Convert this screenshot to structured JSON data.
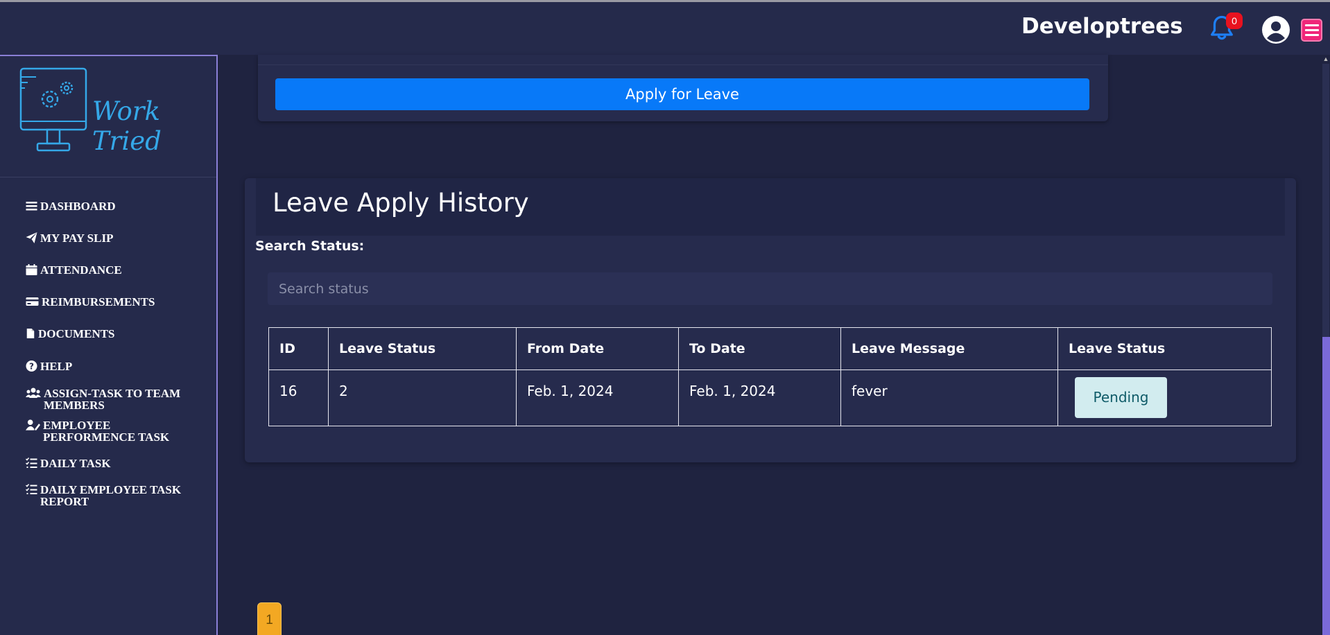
{
  "header": {
    "brand": "Developtrees",
    "notification_count": "0"
  },
  "sidebar": {
    "logo_text": "Work Tried",
    "items": [
      {
        "label": "DASHBOARD",
        "icon": "bars-icon"
      },
      {
        "label": "MY PAY SLIP",
        "icon": "paper-plane-icon"
      },
      {
        "label": "ATTENDANCE",
        "icon": "calendar-icon"
      },
      {
        "label": "REIMBURSEMENTS",
        "icon": "credit-card-icon"
      },
      {
        "label": "DOCUMENTS",
        "icon": "file-icon"
      },
      {
        "label": "HELP",
        "icon": "question-circle-icon"
      },
      {
        "label": "ASSIGN-TASK TO TEAM MEMBERS",
        "icon": "users-icon"
      },
      {
        "label": "EMPLOYEE PERFORMENCE TASK",
        "icon": "user-edit-icon"
      },
      {
        "label": "DAILY TASK",
        "icon": "list-check-icon"
      },
      {
        "label": "DAILY EMPLOYEE TASK REPORT",
        "icon": "list-check-icon"
      }
    ]
  },
  "apply": {
    "button_label": "Apply for Leave"
  },
  "history": {
    "title": "Leave Apply History",
    "search_label": "Search Status:",
    "search_placeholder": "Search status",
    "columns": [
      "ID",
      "Leave Status",
      "From Date",
      "To Date",
      "Leave Message",
      "Leave Status"
    ],
    "rows": [
      {
        "id": "16",
        "leave_status": "2",
        "from_date": "Feb. 1, 2024",
        "to_date": "Feb. 1, 2024",
        "message": "fever",
        "status_badge": "Pending"
      }
    ]
  },
  "pagination": {
    "current_page": "1"
  },
  "colors": {
    "background": "#1f2340",
    "panel": "#262b4d",
    "primary": "#0879f8",
    "accent_pink": "#f0267a",
    "badge_red": "#e8121f",
    "page_orange": "#f3a823",
    "logo_blue": "#35a8e8"
  }
}
